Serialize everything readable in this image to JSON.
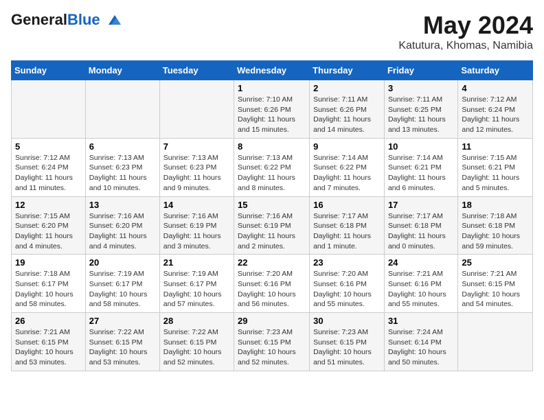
{
  "header": {
    "logo_general": "General",
    "logo_blue": "Blue",
    "month_year": "May 2024",
    "location": "Katutura, Khomas, Namibia"
  },
  "weekdays": [
    "Sunday",
    "Monday",
    "Tuesday",
    "Wednesday",
    "Thursday",
    "Friday",
    "Saturday"
  ],
  "weeks": [
    [
      {
        "day": "",
        "info": ""
      },
      {
        "day": "",
        "info": ""
      },
      {
        "day": "",
        "info": ""
      },
      {
        "day": "1",
        "info": "Sunrise: 7:10 AM\nSunset: 6:26 PM\nDaylight: 11 hours and 15 minutes."
      },
      {
        "day": "2",
        "info": "Sunrise: 7:11 AM\nSunset: 6:26 PM\nDaylight: 11 hours and 14 minutes."
      },
      {
        "day": "3",
        "info": "Sunrise: 7:11 AM\nSunset: 6:25 PM\nDaylight: 11 hours and 13 minutes."
      },
      {
        "day": "4",
        "info": "Sunrise: 7:12 AM\nSunset: 6:24 PM\nDaylight: 11 hours and 12 minutes."
      }
    ],
    [
      {
        "day": "5",
        "info": "Sunrise: 7:12 AM\nSunset: 6:24 PM\nDaylight: 11 hours and 11 minutes."
      },
      {
        "day": "6",
        "info": "Sunrise: 7:13 AM\nSunset: 6:23 PM\nDaylight: 11 hours and 10 minutes."
      },
      {
        "day": "7",
        "info": "Sunrise: 7:13 AM\nSunset: 6:23 PM\nDaylight: 11 hours and 9 minutes."
      },
      {
        "day": "8",
        "info": "Sunrise: 7:13 AM\nSunset: 6:22 PM\nDaylight: 11 hours and 8 minutes."
      },
      {
        "day": "9",
        "info": "Sunrise: 7:14 AM\nSunset: 6:22 PM\nDaylight: 11 hours and 7 minutes."
      },
      {
        "day": "10",
        "info": "Sunrise: 7:14 AM\nSunset: 6:21 PM\nDaylight: 11 hours and 6 minutes."
      },
      {
        "day": "11",
        "info": "Sunrise: 7:15 AM\nSunset: 6:21 PM\nDaylight: 11 hours and 5 minutes."
      }
    ],
    [
      {
        "day": "12",
        "info": "Sunrise: 7:15 AM\nSunset: 6:20 PM\nDaylight: 11 hours and 4 minutes."
      },
      {
        "day": "13",
        "info": "Sunrise: 7:16 AM\nSunset: 6:20 PM\nDaylight: 11 hours and 4 minutes."
      },
      {
        "day": "14",
        "info": "Sunrise: 7:16 AM\nSunset: 6:19 PM\nDaylight: 11 hours and 3 minutes."
      },
      {
        "day": "15",
        "info": "Sunrise: 7:16 AM\nSunset: 6:19 PM\nDaylight: 11 hours and 2 minutes."
      },
      {
        "day": "16",
        "info": "Sunrise: 7:17 AM\nSunset: 6:18 PM\nDaylight: 11 hours and 1 minute."
      },
      {
        "day": "17",
        "info": "Sunrise: 7:17 AM\nSunset: 6:18 PM\nDaylight: 11 hours and 0 minutes."
      },
      {
        "day": "18",
        "info": "Sunrise: 7:18 AM\nSunset: 6:18 PM\nDaylight: 10 hours and 59 minutes."
      }
    ],
    [
      {
        "day": "19",
        "info": "Sunrise: 7:18 AM\nSunset: 6:17 PM\nDaylight: 10 hours and 58 minutes."
      },
      {
        "day": "20",
        "info": "Sunrise: 7:19 AM\nSunset: 6:17 PM\nDaylight: 10 hours and 58 minutes."
      },
      {
        "day": "21",
        "info": "Sunrise: 7:19 AM\nSunset: 6:17 PM\nDaylight: 10 hours and 57 minutes."
      },
      {
        "day": "22",
        "info": "Sunrise: 7:20 AM\nSunset: 6:16 PM\nDaylight: 10 hours and 56 minutes."
      },
      {
        "day": "23",
        "info": "Sunrise: 7:20 AM\nSunset: 6:16 PM\nDaylight: 10 hours and 55 minutes."
      },
      {
        "day": "24",
        "info": "Sunrise: 7:21 AM\nSunset: 6:16 PM\nDaylight: 10 hours and 55 minutes."
      },
      {
        "day": "25",
        "info": "Sunrise: 7:21 AM\nSunset: 6:15 PM\nDaylight: 10 hours and 54 minutes."
      }
    ],
    [
      {
        "day": "26",
        "info": "Sunrise: 7:21 AM\nSunset: 6:15 PM\nDaylight: 10 hours and 53 minutes."
      },
      {
        "day": "27",
        "info": "Sunrise: 7:22 AM\nSunset: 6:15 PM\nDaylight: 10 hours and 53 minutes."
      },
      {
        "day": "28",
        "info": "Sunrise: 7:22 AM\nSunset: 6:15 PM\nDaylight: 10 hours and 52 minutes."
      },
      {
        "day": "29",
        "info": "Sunrise: 7:23 AM\nSunset: 6:15 PM\nDaylight: 10 hours and 52 minutes."
      },
      {
        "day": "30",
        "info": "Sunrise: 7:23 AM\nSunset: 6:15 PM\nDaylight: 10 hours and 51 minutes."
      },
      {
        "day": "31",
        "info": "Sunrise: 7:24 AM\nSunset: 6:14 PM\nDaylight: 10 hours and 50 minutes."
      },
      {
        "day": "",
        "info": ""
      }
    ]
  ]
}
